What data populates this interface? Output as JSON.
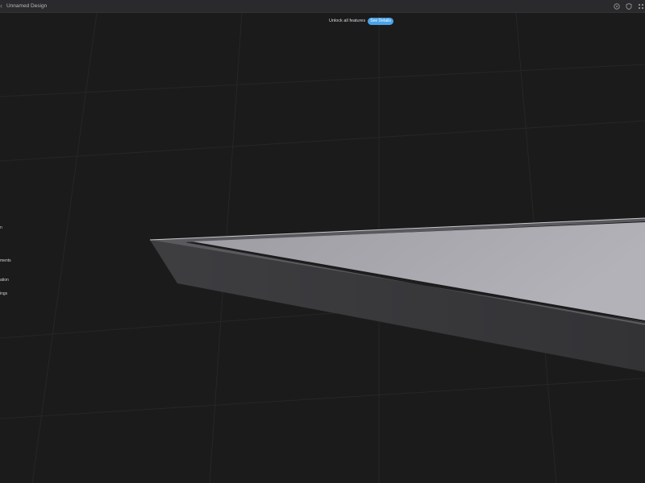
{
  "app": {
    "document_title": "Unnamed Design"
  },
  "titlebar": {
    "icons": [
      "help-circle-icon",
      "shield-icon",
      "grid-icon"
    ]
  },
  "banner": {
    "text": "Unlock all features",
    "button_label": "See Details",
    "accent_color": "#4aa3e8"
  },
  "side_panel": {
    "items": [
      {
        "label": "n"
      },
      {
        "label": "ments"
      },
      {
        "label": "ation"
      },
      {
        "label": "ings"
      }
    ]
  },
  "colors": {
    "background": "#1b1b1c",
    "titlebar": "#2a2a2c",
    "slab_top": "#a8a8ae",
    "slab_side": "#3a3a3d"
  }
}
